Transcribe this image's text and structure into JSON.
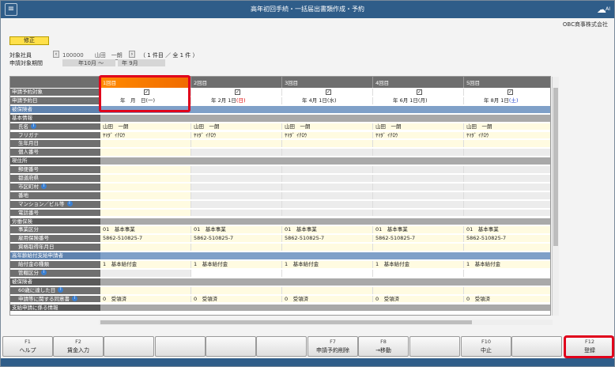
{
  "window": {
    "title": "高年初回手続・一括届出書類作成・予約",
    "company": "OBC商事株式会社",
    "brand_sub": "AI"
  },
  "mode_button": "修正",
  "target_employee_label": "対象社員",
  "target_employee_code": "100000",
  "target_employee_name": "山田　一朗",
  "count_text": "（ 1 件目 ／ 全 1 件 ）",
  "period_label": "申請対象期間",
  "period_from": "年10月 〜",
  "period_to": "年 9月",
  "columns": [
    {
      "label": "1回目",
      "check": "✓",
      "date": "年　月　日(一)"
    },
    {
      "label": "2回目",
      "check": "✓",
      "date_pre": "年 2月 1日",
      "date_day": "(日)",
      "day_color": "red"
    },
    {
      "label": "3回目",
      "check": "✓",
      "date_pre": "年 4月 1日",
      "date_day": "(水)",
      "day_color": ""
    },
    {
      "label": "4回目",
      "check": "✓",
      "date_pre": "年 6月 1日",
      "date_day": "(月)",
      "day_color": ""
    },
    {
      "label": "5回目",
      "check": "✓",
      "date_pre": "年 8月 1日",
      "date_day": "(土)",
      "day_color": "blue"
    }
  ],
  "rows": [
    {
      "label": "申請予約対象",
      "type": "check"
    },
    {
      "label": "申請予約日",
      "type": "date"
    },
    {
      "label": "被保険者",
      "type": "blue"
    },
    {
      "label": "基本情報",
      "type": "gr"
    },
    {
      "label": "氏名",
      "info": true,
      "sub": true,
      "values": [
        "山田　一朗",
        "山田　一朗",
        "山田　一朗",
        "山田　一朗",
        "山田　一朗"
      ]
    },
    {
      "label": "フリガナ",
      "sub": true,
      "values": [
        "ﾔﾏﾀﾞ ｲﾁﾛｳ",
        "ﾔﾏﾀﾞ ｲﾁﾛｳ",
        "ﾔﾏﾀﾞ ｲﾁﾛｳ",
        "ﾔﾏﾀﾞ ｲﾁﾛｳ",
        "ﾔﾏﾀﾞ ｲﾁﾛｳ"
      ]
    },
    {
      "label": "生年月日",
      "sub": true,
      "values": [
        "",
        "",
        "",
        "",
        ""
      ]
    },
    {
      "label": "個人番号",
      "sub": true,
      "values": [
        "",
        "",
        "",
        "",
        ""
      ],
      "firstYellow": true
    },
    {
      "label": "現住所",
      "type": "gr"
    },
    {
      "label": "郵便番号",
      "sub": true,
      "values": [
        "",
        "",
        "",
        "",
        ""
      ],
      "firstYellow": true
    },
    {
      "label": "都道府県",
      "sub": true,
      "values": [
        "",
        "",
        "",
        "",
        ""
      ],
      "firstYellow": true
    },
    {
      "label": "市区町村",
      "info": true,
      "sub": true,
      "values": [
        "",
        "",
        "",
        "",
        ""
      ],
      "firstYellow": true
    },
    {
      "label": "番地",
      "sub": true,
      "values": [
        "",
        "",
        "",
        "",
        ""
      ],
      "firstYellow": true
    },
    {
      "label": "マンション／ビル等",
      "info": true,
      "sub": true,
      "values": [
        "",
        "",
        "",
        "",
        ""
      ],
      "firstYellow": true
    },
    {
      "label": "電話番号",
      "sub": true,
      "values": [
        "",
        "",
        "",
        "",
        ""
      ],
      "firstYellow": true
    },
    {
      "label": "労働保険",
      "type": "gr"
    },
    {
      "label": "事業区分",
      "sub": true,
      "values": [
        "01　基本事業",
        "01　基本事業",
        "01　基本事業",
        "01　基本事業",
        "01　基本事業"
      ]
    },
    {
      "label": "雇用保険番号",
      "sub": true,
      "values": [
        "5862-510825-7",
        "5862-510825-7",
        "5862-510825-7",
        "5862-510825-7",
        "5862-510825-7"
      ]
    },
    {
      "label": "資格取得年月日",
      "sub": true,
      "values": [
        "",
        "",
        "",
        "",
        ""
      ]
    },
    {
      "label": "高年齢給付支給申請者",
      "type": "blue"
    },
    {
      "label": "給付金の種類",
      "sub": true,
      "values": [
        "1　基本給付金",
        "1　基本給付金",
        "1　基本給付金",
        "1　基本給付金",
        "1　基本給付金"
      ]
    },
    {
      "label": "管轄区分",
      "info": true,
      "sub": true,
      "values": [
        "",
        "",
        "",
        "",
        ""
      ],
      "firstGrey": true
    },
    {
      "label": "被保険者",
      "type": "gr"
    },
    {
      "label": "60歳に達した日",
      "info": true,
      "sub": true,
      "values": [
        "",
        "",
        "",
        "",
        ""
      ]
    },
    {
      "label": "申請等に関する同意書",
      "info": true,
      "sub": true,
      "values": [
        "0　受領済",
        "0　受領済",
        "0　受領済",
        "0　受領済",
        "0　受領済"
      ]
    },
    {
      "label": "支給申請に係る情報",
      "type": "gr"
    }
  ],
  "fkeys": [
    {
      "n": "F1",
      "t": "ヘルプ"
    },
    {
      "n": "F2",
      "t": "賃金入力"
    },
    {
      "n": "",
      "t": ""
    },
    {
      "n": "",
      "t": ""
    },
    {
      "n": "",
      "t": ""
    },
    {
      "n": "",
      "t": ""
    },
    {
      "n": "F7",
      "t": "申請予約削除"
    },
    {
      "n": "F8",
      "t": "→移動"
    },
    {
      "n": "",
      "t": ""
    },
    {
      "n": "F10",
      "t": "中止"
    },
    {
      "n": "",
      "t": ""
    },
    {
      "n": "F12",
      "t": "登録"
    }
  ]
}
